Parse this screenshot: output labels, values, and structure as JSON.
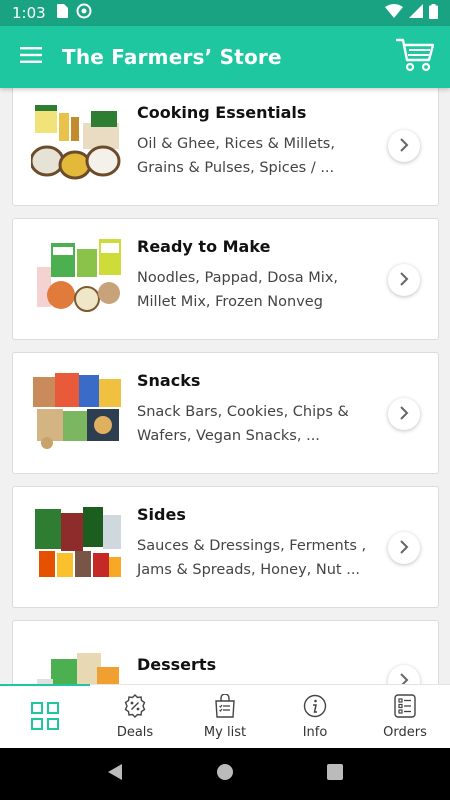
{
  "status_bar": {
    "time": "1:03"
  },
  "app_bar": {
    "title": "The Farmers’ Store",
    "menu_icon": "hamburger-menu-icon",
    "cart_icon": "shopping-cart-icon"
  },
  "colors": {
    "accent": "#1ec7a0",
    "status_bar": "#1aa383"
  },
  "categories": [
    {
      "title": "Cooking Essentials",
      "line1": "Oil & Ghee, Rices & Millets,",
      "line2": "Grains & Pulses, Spices / ..."
    },
    {
      "title": "Ready to Make",
      "line1": "Noodles, Pappad, Dosa Mix,",
      "line2": "Millet Mix, Frozen Nonveg"
    },
    {
      "title": "Snacks",
      "line1": "Snack Bars, Cookies, Chips &",
      "line2": "Wafers, Vegan Snacks, ..."
    },
    {
      "title": "Sides",
      "line1": "Sauces & Dressings, Ferments ,",
      "line2": "Jams & Spreads, Honey, Nut ..."
    },
    {
      "title": "Desserts",
      "line1": "",
      "line2": ""
    }
  ],
  "bottom_nav": [
    {
      "label": "",
      "icon": "grid-icon",
      "active": true
    },
    {
      "label": "Deals",
      "icon": "discount-badge-icon"
    },
    {
      "label": "My list",
      "icon": "shopping-list-bag-icon"
    },
    {
      "label": "Info",
      "icon": "info-icon"
    },
    {
      "label": "Orders",
      "icon": "orders-list-icon"
    }
  ]
}
